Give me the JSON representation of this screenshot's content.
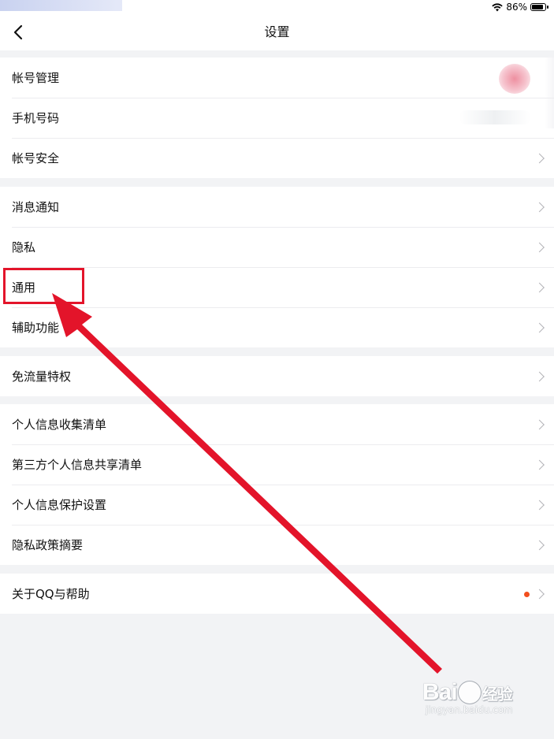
{
  "status_bar": {
    "battery_text": "86%",
    "battery_level": 0.86,
    "icons": [
      "wifi-icon",
      "battery-icon"
    ]
  },
  "nav": {
    "title": "设置",
    "back_icon": "chevron-left-icon"
  },
  "groups": [
    {
      "items": [
        {
          "label": "帐号管理"
        },
        {
          "label": "手机号码"
        },
        {
          "label": "帐号安全"
        }
      ]
    },
    {
      "items": [
        {
          "label": "消息通知"
        },
        {
          "label": "隐私"
        },
        {
          "label": "通用"
        },
        {
          "label": "辅助功能"
        }
      ]
    },
    {
      "items": [
        {
          "label": "免流量特权"
        }
      ]
    },
    {
      "items": [
        {
          "label": "个人信息收集清单"
        },
        {
          "label": "第三方个人信息共享清单"
        },
        {
          "label": "个人信息保护设置"
        },
        {
          "label": "隐私政策摘要"
        }
      ]
    },
    {
      "items": [
        {
          "label": "关于QQ与帮助"
        }
      ]
    }
  ],
  "annotation": {
    "highlight_color": "#e3142a"
  },
  "watermark": {
    "logo": "Bai",
    "logo_cn": "经验",
    "sub": "jingyan.baidu.com"
  },
  "colors": {
    "background": "#f2f3f5",
    "red_dot": "#f24e1e",
    "chevron": "#b3b3b8"
  }
}
